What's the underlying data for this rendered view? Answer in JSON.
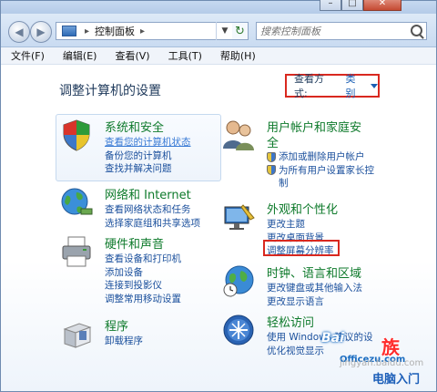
{
  "address": {
    "crumb": "控制面板"
  },
  "search": {
    "placeholder": "搜索控制面板"
  },
  "menu": [
    "文件(F)",
    "编辑(E)",
    "查看(V)",
    "工具(T)",
    "帮助(H)"
  ],
  "page": {
    "title": "调整计算机的设置"
  },
  "view_by": {
    "label": "查看方式:",
    "value": "类别"
  },
  "categories": {
    "system": {
      "title": "系统和安全",
      "links": [
        "查看您的计算机状态",
        "备份您的计算机",
        "查找并解决问题"
      ]
    },
    "network": {
      "title": "网络和 Internet",
      "links": [
        "查看网络状态和任务",
        "选择家庭组和共享选项"
      ]
    },
    "hardware": {
      "title": "硬件和声音",
      "links": [
        "查看设备和打印机",
        "添加设备",
        "连接到投影仪",
        "调整常用移动设置"
      ]
    },
    "programs": {
      "title": "程序",
      "links": [
        "卸载程序"
      ]
    },
    "users": {
      "title": "用户帐户和家庭安",
      "title2": "全",
      "links": [
        "添加或删除用户帐户",
        "为所有用户设置家长控",
        "制"
      ]
    },
    "appearance": {
      "title": "外观和个性化",
      "links": [
        "更改主题",
        "更改桌面背景",
        "调整屏幕分辨率"
      ]
    },
    "clock": {
      "title": "时钟、语言和区域",
      "links": [
        "更改键盘或其他输入法",
        "更改显示语言"
      ]
    },
    "ease": {
      "title": "轻松访问",
      "links": [
        "使用 Windows 建议的设",
        "优化视觉显示"
      ]
    }
  },
  "watermark": {
    "baidu": "Bai",
    "site": "Officezu.com",
    "jingyan": "jingyan.baidu.com",
    "brand": "电脑入门",
    "badge": "族"
  }
}
